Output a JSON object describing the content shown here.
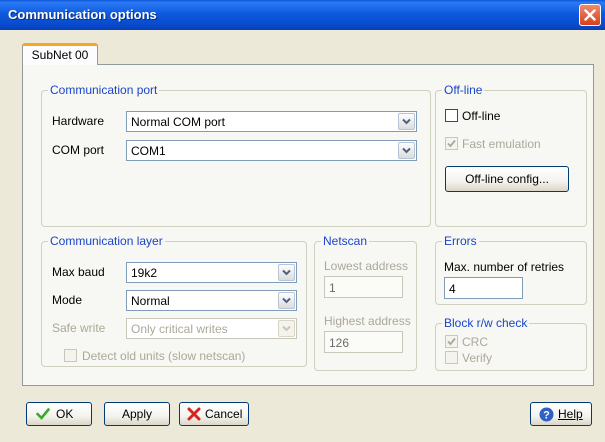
{
  "window": {
    "title": "Communication options"
  },
  "tabs": [
    {
      "label": "SubNet 00"
    }
  ],
  "comm_port": {
    "title": "Communication port",
    "hardware_label": "Hardware",
    "hardware_value": "Normal COM port",
    "com_port_label": "COM port",
    "com_port_value": "COM1"
  },
  "offline": {
    "title": "Off-line",
    "offline_checkbox_label": "Off-line",
    "offline_checked": false,
    "fast_emulation_label": "Fast emulation",
    "fast_emulation_checked": true,
    "config_button_label": "Off-line config..."
  },
  "comm_layer": {
    "title": "Communication layer",
    "max_baud_label": "Max baud",
    "max_baud_value": "19k2",
    "mode_label": "Mode",
    "mode_value": "Normal",
    "safe_write_label": "Safe write",
    "safe_write_value": "Only critical writes",
    "detect_old_label": "Detect old units (slow netscan)",
    "detect_old_checked": false
  },
  "netscan": {
    "title": "Netscan",
    "lowest_label": "Lowest address",
    "lowest_value": "1",
    "highest_label": "Highest address",
    "highest_value": "126"
  },
  "errors": {
    "title": "Errors",
    "retries_label": "Max. number of retries",
    "retries_value": "4"
  },
  "block_check": {
    "title": "Block r/w check",
    "crc_label": "CRC",
    "crc_checked": true,
    "verify_label": "Verify",
    "verify_checked": false
  },
  "buttons": {
    "ok_label": "OK",
    "apply_label": "Apply",
    "cancel_label": "Cancel",
    "help_label": "Help"
  },
  "colors": {
    "titlebar": "#0a54d8",
    "group_title": "#1a46c8",
    "tab_highlight": "#f5a623",
    "ok_icon": "#3aa82a",
    "cancel_icon": "#d8231f",
    "help_icon": "#2f60c4"
  }
}
